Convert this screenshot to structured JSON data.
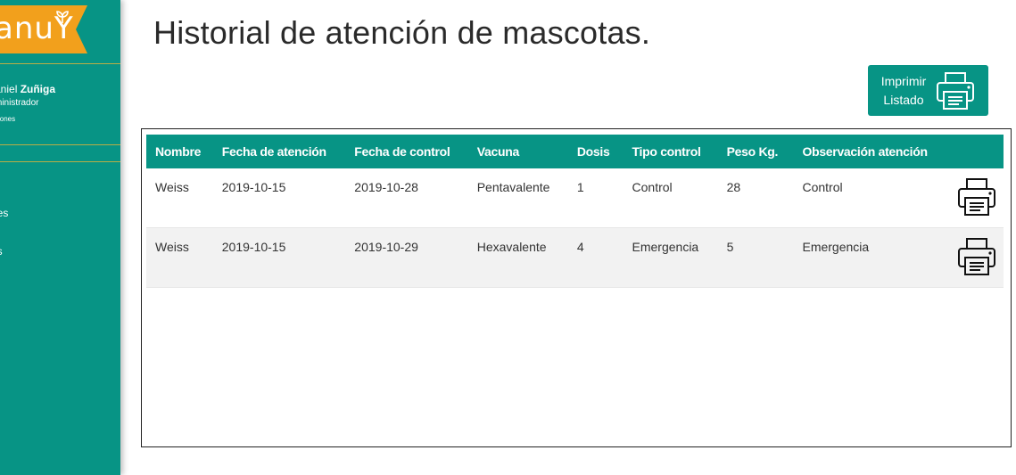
{
  "sidebar": {
    "logo_text": "anuY",
    "user_first": "aniel ",
    "user_last": "Zuñiga",
    "user_role": "ministrador",
    "user_options": "ciones",
    "nav": [
      "nes",
      "as"
    ],
    "colors": {
      "bg": "#079485",
      "accent": "#f2a01c",
      "divider": "#d9b43a"
    }
  },
  "page": {
    "title": "Historial de atención de mascotas."
  },
  "print_button": {
    "line1": "Imprimir",
    "line2": "Listado",
    "icon": "printer-icon"
  },
  "table": {
    "headers": [
      "Nombre",
      "Fecha de atención",
      "Fecha de control",
      "Vacuna",
      "Dosis",
      "Tipo control",
      "Peso Kg.",
      "Observación atención"
    ],
    "rows": [
      {
        "nombre": "Weiss",
        "fecha_atencion": "2019-10-15",
        "fecha_control": "2019-10-28",
        "vacuna": "Pentavalente",
        "dosis": "1",
        "tipo": "Control",
        "peso": "28",
        "obs": "Control",
        "icon": "printer-icon"
      },
      {
        "nombre": "Weiss",
        "fecha_atencion": "2019-10-15",
        "fecha_control": "2019-10-29",
        "vacuna": "Hexavalente",
        "dosis": "4",
        "tipo": "Emergencia",
        "peso": "5",
        "obs": "Emergencia",
        "icon": "printer-icon"
      }
    ],
    "header_color": "#079485"
  }
}
